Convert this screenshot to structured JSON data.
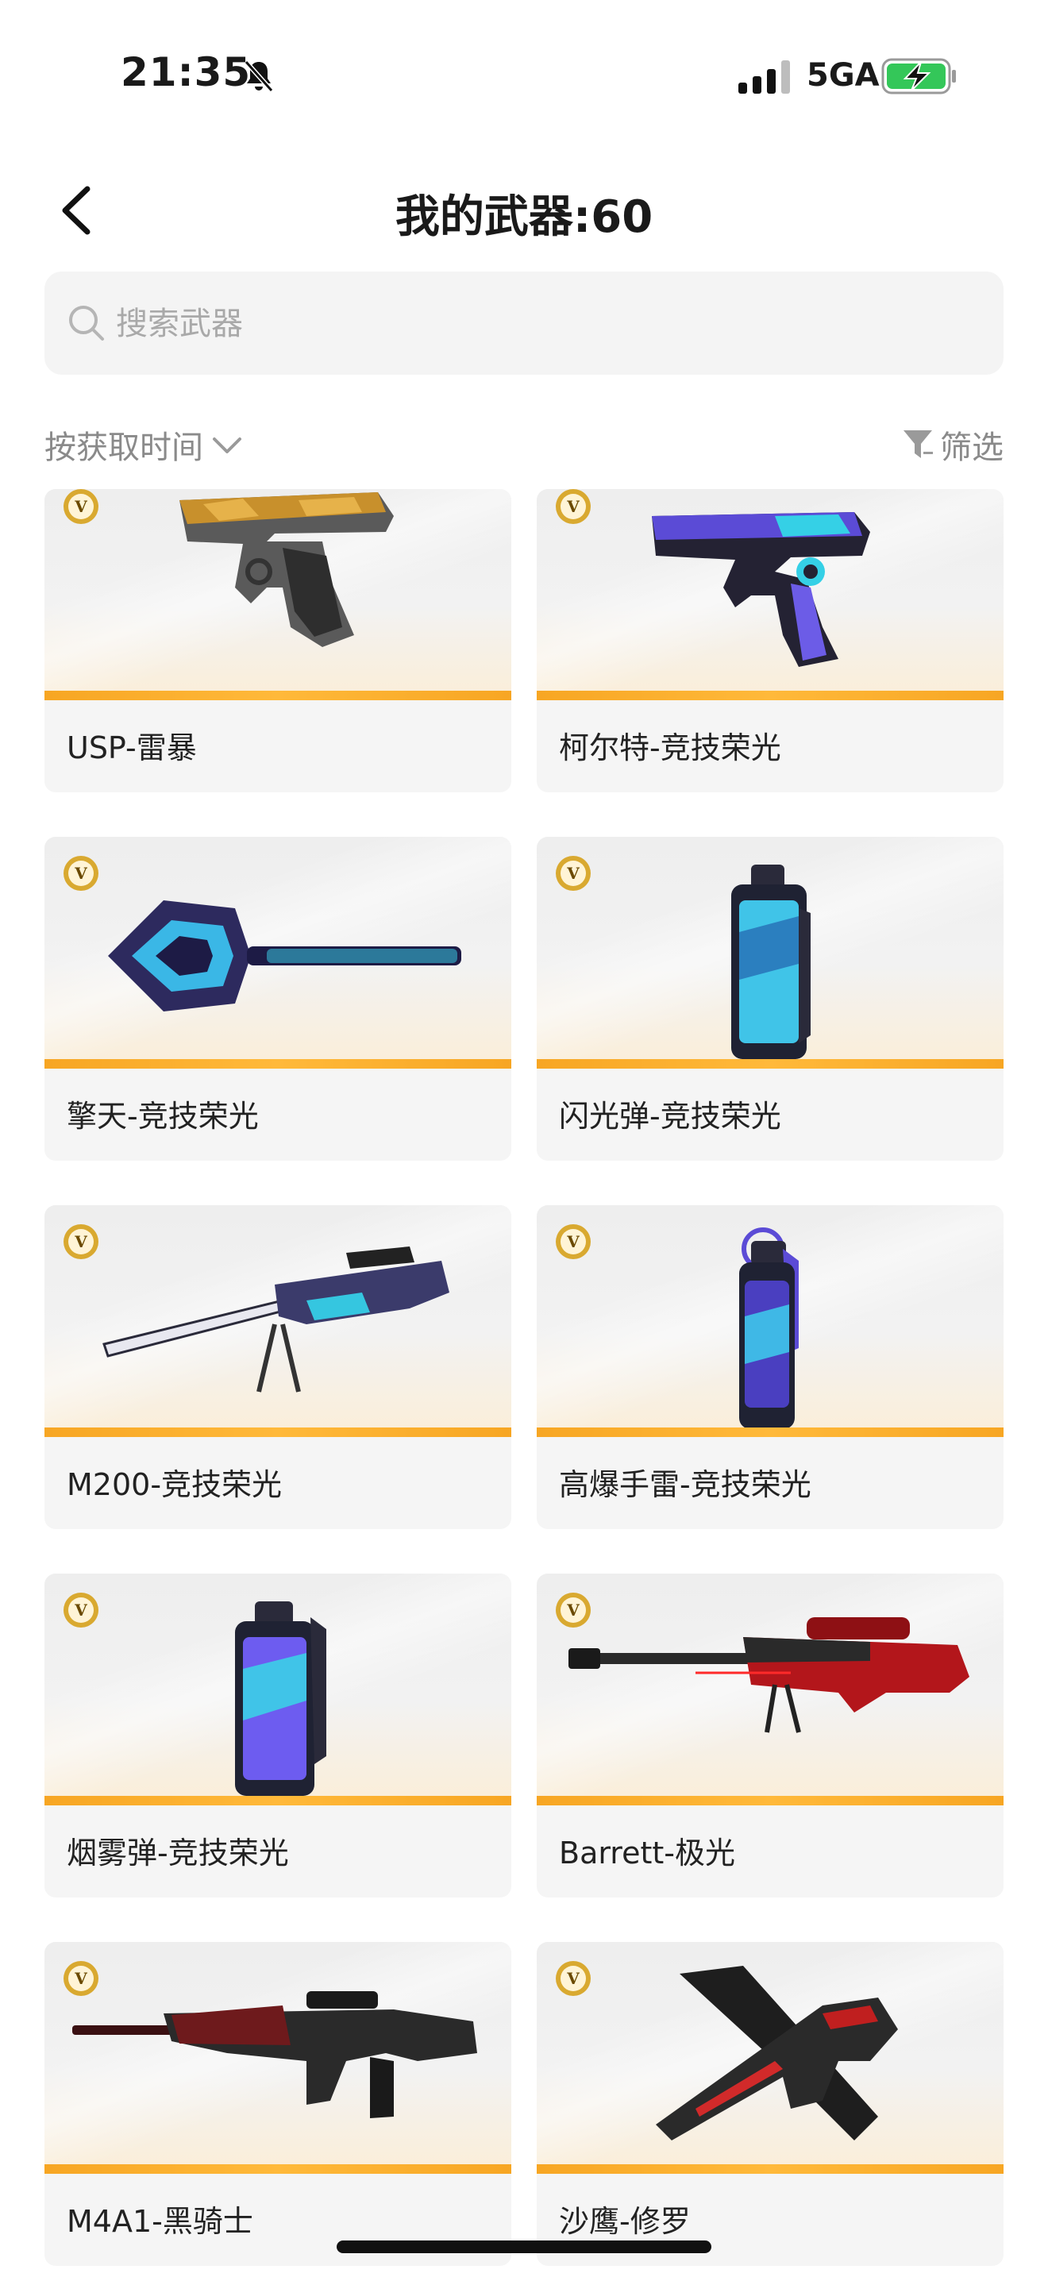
{
  "status_bar": {
    "time": "21:35",
    "network": "5GA",
    "icons": [
      "bell-slash-icon",
      "signal-icon",
      "battery-charging-icon"
    ]
  },
  "header": {
    "title": "我的武器:60",
    "back_icon": "chevron-left-icon"
  },
  "search": {
    "placeholder": "搜索武器",
    "value": ""
  },
  "toolbar": {
    "sort_label": "按获取时间",
    "filter_label": "筛选"
  },
  "colors": {
    "accent_stripe": "#f7a623",
    "card_bg": "#f5f5f5",
    "badge_gold": "#d9a930"
  },
  "weapons": [
    {
      "name": "USP-雷暴",
      "kind": "pistol-gold"
    },
    {
      "name": "柯尔特-竞技荣光",
      "kind": "pistol-purple"
    },
    {
      "name": "擎天-竞技荣光",
      "kind": "shovel"
    },
    {
      "name": "闪光弹-竞技荣光",
      "kind": "grenade-can"
    },
    {
      "name": "M200-竞技荣光",
      "kind": "sniper-purple"
    },
    {
      "name": "高爆手雷-竞技荣光",
      "kind": "grenade-pin"
    },
    {
      "name": "烟雾弹-竞技荣光",
      "kind": "grenade-can"
    },
    {
      "name": "Barrett-极光",
      "kind": "sniper-red"
    },
    {
      "name": "M4A1-黑骑士",
      "kind": "rifle"
    },
    {
      "name": "沙鹰-修罗",
      "kind": "pistol-dark"
    }
  ]
}
